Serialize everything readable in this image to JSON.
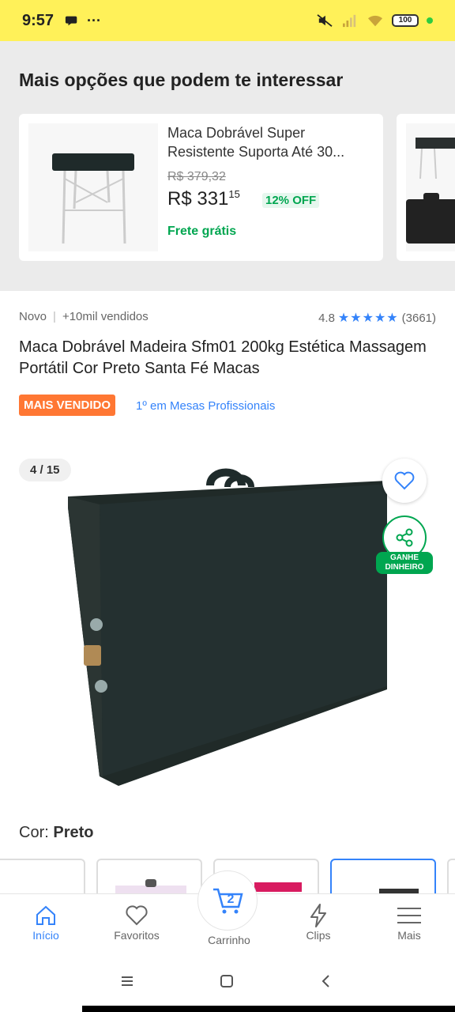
{
  "status_bar": {
    "time": "9:57",
    "battery": "100"
  },
  "recommendations": {
    "title": "Mais opções que podem te interessar",
    "card": {
      "name": "Maca Dobrável Super Resistente Suporta Até 30...",
      "old_price": "R$ 379,32",
      "price_main": "R$ 331",
      "price_cents": "15",
      "discount": "12% OFF",
      "shipping": "Frete grátis"
    }
  },
  "product": {
    "condition": "Novo",
    "sold": "+10mil vendidos",
    "rating": "4.8",
    "stars": "★★★★★",
    "reviews": "(3661)",
    "title": "Maca Dobrável Madeira Sfm01 200kg Estética Massagem Portátil Cor Preto Santa Fé Macas",
    "badge": "MAIS VENDIDO",
    "ranking": "1º em Mesas Profissionais"
  },
  "gallery": {
    "counter": "4 / 15",
    "earn_label_1": "GANHE",
    "earn_label_2": "DINHEIRO"
  },
  "color": {
    "label": "Cor:",
    "value": "Preto"
  },
  "bottom_nav": {
    "items": [
      {
        "label": "Início",
        "icon": "home-icon"
      },
      {
        "label": "Favoritos",
        "icon": "heart-icon"
      },
      {
        "label": "Carrinho",
        "icon": "cart-icon",
        "badge": "2"
      },
      {
        "label": "Clips",
        "icon": "lightning-icon"
      },
      {
        "label": "Mais",
        "icon": "menu-icon"
      }
    ]
  },
  "colors": {
    "brand_yellow": "#fff159",
    "accent_blue": "#3483fa",
    "green": "#00a650",
    "orange": "#ff7733"
  }
}
